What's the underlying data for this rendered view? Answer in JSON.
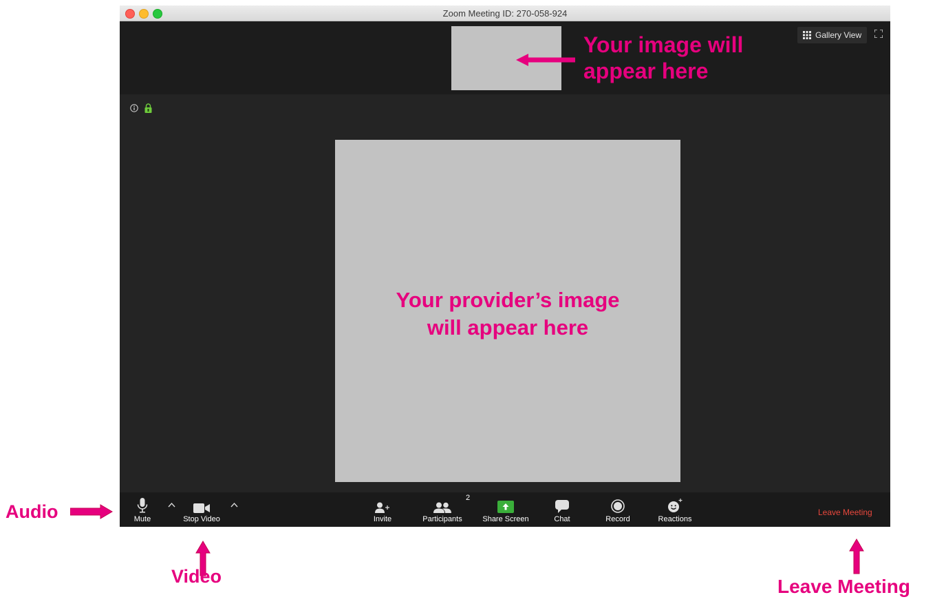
{
  "window": {
    "title": "Zoom Meeting ID: 270-058-924"
  },
  "top_bar": {
    "gallery_view_label": "Gallery View",
    "gallery_icon": "grid-icon",
    "fullscreen_icon": "fullscreen-icon"
  },
  "toolbar": {
    "mute_label": "Mute",
    "stop_video_label": "Stop Video",
    "invite_label": "Invite",
    "participants_label": "Participants",
    "participants_count": "2",
    "share_screen_label": "Share Screen",
    "chat_label": "Chat",
    "record_label": "Record",
    "reactions_label": "Reactions",
    "leave_label": "Leave Meeting"
  },
  "annotations": {
    "self_image_line1": "Your image will",
    "self_image_line2": "appear here",
    "provider_line1": "Your provider’s image",
    "provider_line2": "will appear here",
    "audio": "Audio",
    "video": "Video",
    "leave_meeting": "Leave Meeting"
  },
  "colors": {
    "annotation": "#e6007e",
    "leave": "#e8473c",
    "share_screen": "#3aaf3a",
    "placeholder": "#c2c2c2"
  }
}
